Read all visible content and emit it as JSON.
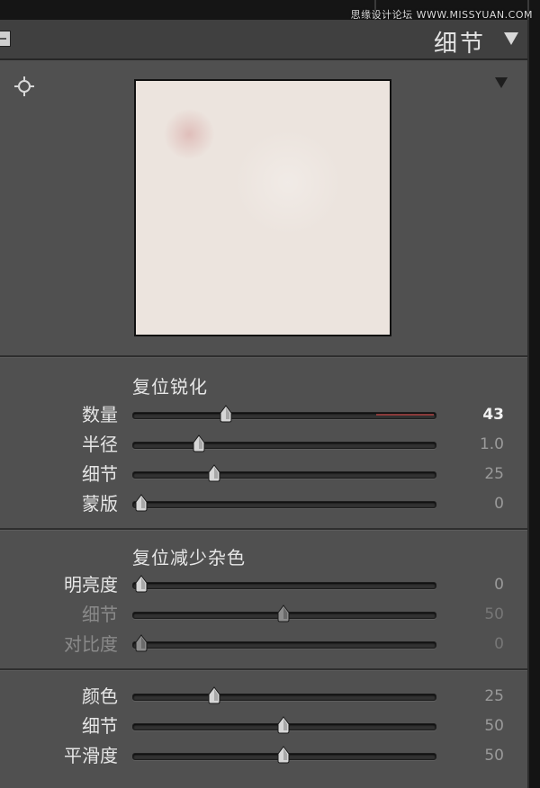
{
  "watermark": "思缘设计论坛 WWW.MISSYUAN.COM",
  "panel": {
    "title": "细节"
  },
  "colors": {
    "panel_bg": "#505050",
    "header_bg": "#404040",
    "track": "#333333",
    "text": "#e6e6e6",
    "dim_text": "#8a8a8a"
  },
  "sharpening": {
    "reset_title": "复位锐化",
    "sliders": [
      {
        "label": "数量",
        "value": "43",
        "fraction": 0.31,
        "active": true
      },
      {
        "label": "半径",
        "value": "1.0",
        "fraction": 0.22
      },
      {
        "label": "细节",
        "value": "25",
        "fraction": 0.27
      },
      {
        "label": "蒙版",
        "value": "0",
        "fraction": 0.03
      }
    ]
  },
  "noise_reduction": {
    "reset_title": "复位减少杂色",
    "luminance_sliders": [
      {
        "label": "明亮度",
        "value": "0",
        "fraction": 0.03
      },
      {
        "label": "细节",
        "value": "50",
        "fraction": 0.5,
        "dim": true
      },
      {
        "label": "对比度",
        "value": "0",
        "fraction": 0.03,
        "dim": true
      }
    ],
    "color_sliders": [
      {
        "label": "颜色",
        "value": "25",
        "fraction": 0.27
      },
      {
        "label": "细节",
        "value": "50",
        "fraction": 0.5
      },
      {
        "label": "平滑度",
        "value": "50",
        "fraction": 0.5
      }
    ]
  }
}
